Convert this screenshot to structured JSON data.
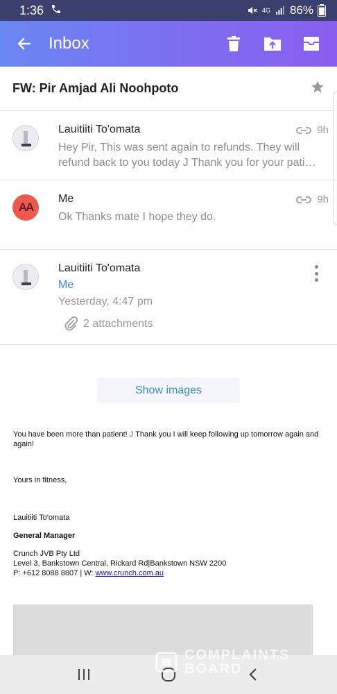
{
  "status_bar": {
    "time": "1:36",
    "battery": "86%",
    "network": "4G"
  },
  "app_bar": {
    "title": "Inbox",
    "icons": [
      "back-arrow-icon",
      "delete-icon",
      "move-folder-icon",
      "archive-icon"
    ]
  },
  "thread": {
    "subject": "FW: Pir Amjad Ali Noohpoto",
    "messages": [
      {
        "sender": "Lauitiiti To'omata",
        "preview_line1": "Hey Pir, This was sent again to refunds. They will",
        "preview_line2": "refund back to you today J Thank you for your pati…",
        "time": "9h",
        "has_attachment": true
      },
      {
        "sender": "Me",
        "avatar_initials": "AA",
        "preview_line1": "Ok Thanks mate I hope they do.",
        "time": "9h",
        "has_attachment": true
      },
      {
        "sender": "Lauitiiti To'omata",
        "to": "Me",
        "date": "Yesterday, 4:47 pm",
        "attachments": "2 attachments"
      }
    ]
  },
  "body": {
    "show_images": "Show images",
    "p1_a": "You have been more than patient! ",
    "p1_j": "J",
    "p1_b": " Thank you I will keep following up tomorrow again and again!",
    "p2": "Yours in fitness,",
    "p3": "Lauitiiti To'omata",
    "p4": "General Manager",
    "p5_line1": "Crunch JVB Pty Ltd",
    "p5_line2": "Level 3, Bankstown Central, Rickard Rd|Bankstown NSW 2200",
    "p5_line3_a": "P: +612 8088 8807 | W: ",
    "p5_link": "www.crunch.com.au"
  },
  "watermark": {
    "line1": "COMPLAINTS",
    "line2": "BOARD"
  },
  "colors": {
    "app_bar_start": "#6a86f2",
    "app_bar_end": "#8a5ef0",
    "link_blue": "#2b8ae0",
    "avatar_red": "#ec5a4f"
  }
}
